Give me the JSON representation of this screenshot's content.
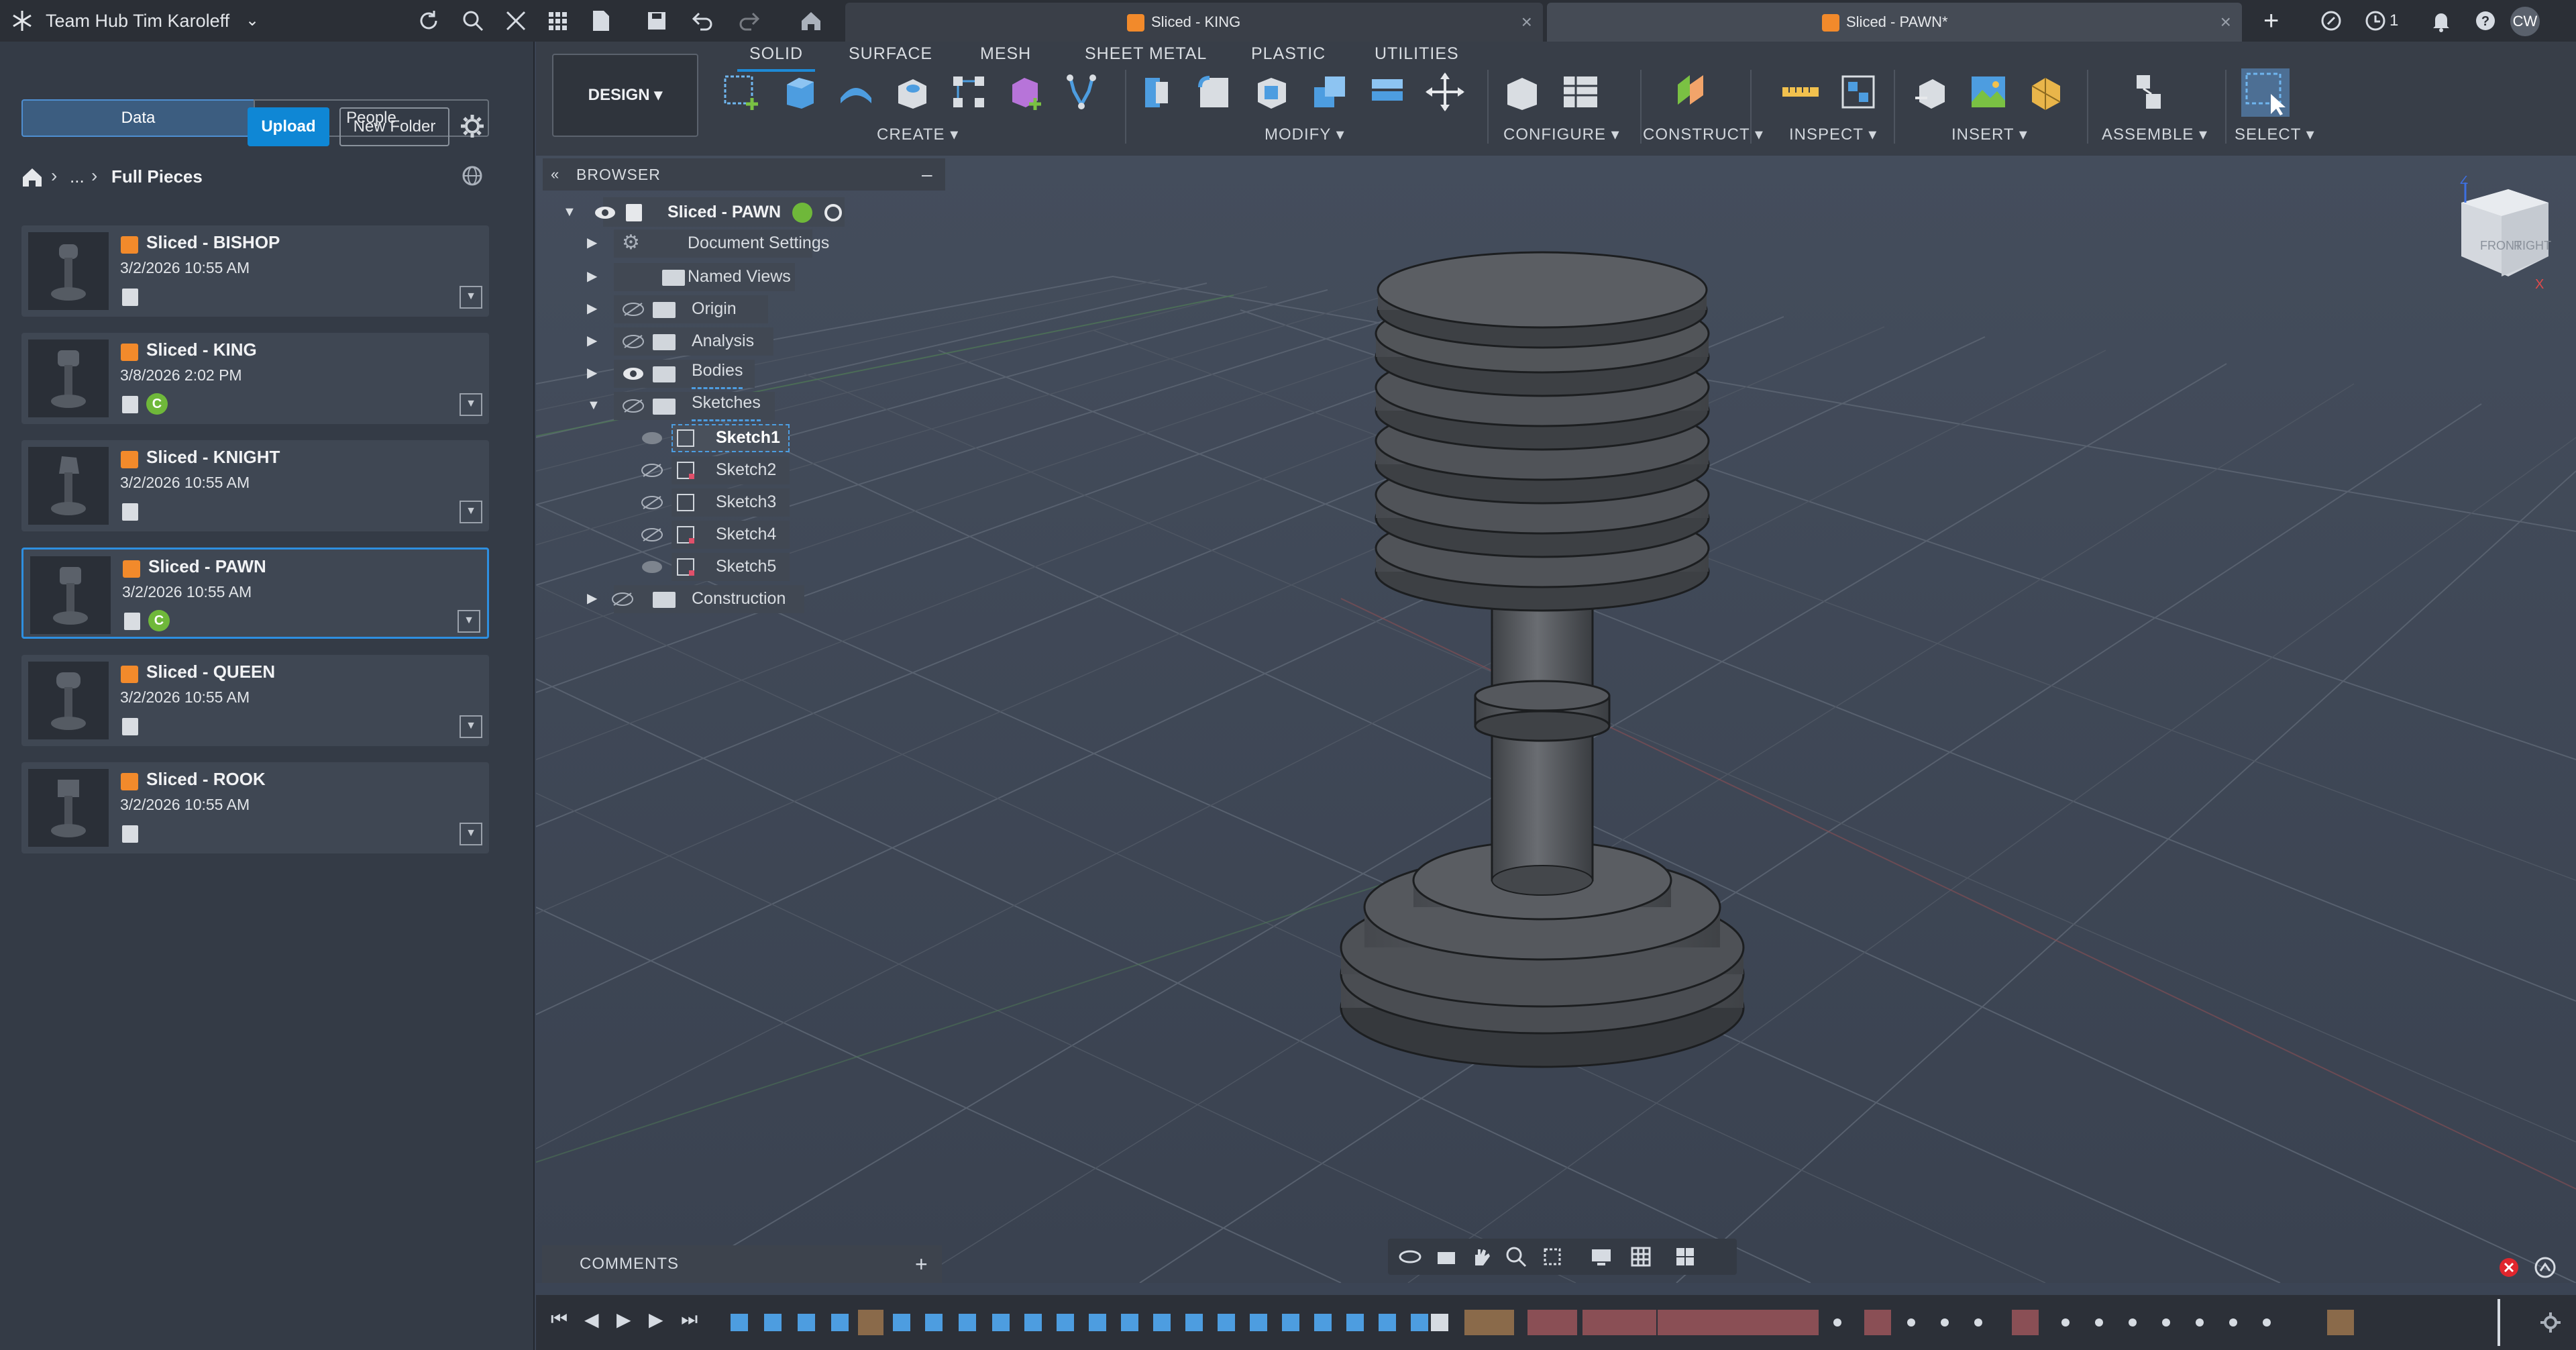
{
  "topbar": {
    "hub": "Team Hub Tim Karoleff",
    "tabs": [
      {
        "label": "Sliced - KING",
        "active": false
      },
      {
        "label": "Sliced - PAWN*",
        "active": true
      }
    ],
    "notif_count": "1",
    "user_initials": "CW"
  },
  "left": {
    "seg_data": "Data",
    "seg_people": "People",
    "upload": "Upload",
    "new_folder": "New Folder",
    "breadcrumb_more": "...",
    "breadcrumb_folder": "Full Pieces",
    "files": [
      {
        "name": "Sliced - BISHOP",
        "date": "3/2/2026 10:55 AM",
        "badge": ""
      },
      {
        "name": "Sliced - KING",
        "date": "3/8/2026 2:02 PM",
        "badge": "C"
      },
      {
        "name": "Sliced - KNIGHT",
        "date": "3/2/2026 10:55 AM",
        "badge": ""
      },
      {
        "name": "Sliced - PAWN",
        "date": "3/2/2026 10:55 AM",
        "badge": "C"
      },
      {
        "name": "Sliced - QUEEN",
        "date": "3/2/2026 10:55 AM",
        "badge": ""
      },
      {
        "name": "Sliced - ROOK",
        "date": "3/2/2026 10:55 AM",
        "badge": ""
      }
    ]
  },
  "toolbar": {
    "design": "DESIGN",
    "tabs": [
      "SOLID",
      "SURFACE",
      "MESH",
      "SHEET METAL",
      "PLASTIC",
      "UTILITIES"
    ],
    "groups": [
      "CREATE",
      "MODIFY",
      "CONFIGURE",
      "CONSTRUCT",
      "INSPECT",
      "INSERT",
      "ASSEMBLE",
      "SELECT"
    ]
  },
  "browser": {
    "title": "BROWSER",
    "root": "Sliced - PAWN",
    "items": [
      "Document Settings",
      "Named Views",
      "Origin",
      "Analysis",
      "Bodies",
      "Sketches"
    ],
    "sketches": [
      "Sketch1",
      "Sketch2",
      "Sketch3",
      "Sketch4",
      "Sketch5"
    ],
    "construction": "Construction"
  },
  "viewcube": {
    "front": "FRONT",
    "right": "RIGHT",
    "z": "Z",
    "x": "X"
  },
  "comments": {
    "label": "COMMENTS",
    "add": "+"
  },
  "colors": {
    "accent": "#1e8ad6",
    "orange": "#f28a2b",
    "badge": "#6fb83a",
    "selection": "#2e8fe0"
  }
}
